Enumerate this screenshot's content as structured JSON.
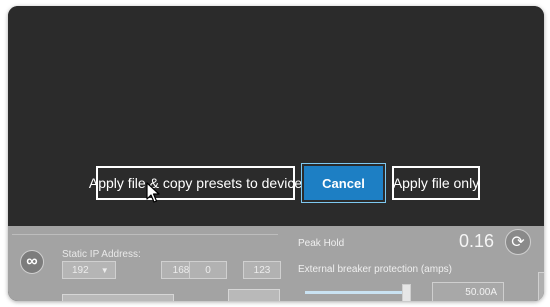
{
  "dialog": {
    "apply_copy_label": "Apply file & copy presets to device",
    "cancel_label": "Cancel",
    "apply_only_label": "Apply file only"
  },
  "network": {
    "static_ip_label": "Static IP Address:",
    "ip_octets": [
      "192",
      "168",
      "0",
      "123"
    ]
  },
  "meter": {
    "peak_hold_label": "Peak Hold",
    "peak_hold_value": "0.16",
    "breaker_label": "External breaker protection (amps)",
    "breaker_value": "50.00A"
  },
  "icons": {
    "infinity": "infinity-icon",
    "refresh": "refresh-icon",
    "dropdown": "chevron-down-icon",
    "cursor": "mouse-cursor-icon"
  },
  "colors": {
    "dialog_background": "#2b2b2b",
    "primary_button": "#1d7fc4",
    "panel_background": "#a3a3a3"
  }
}
